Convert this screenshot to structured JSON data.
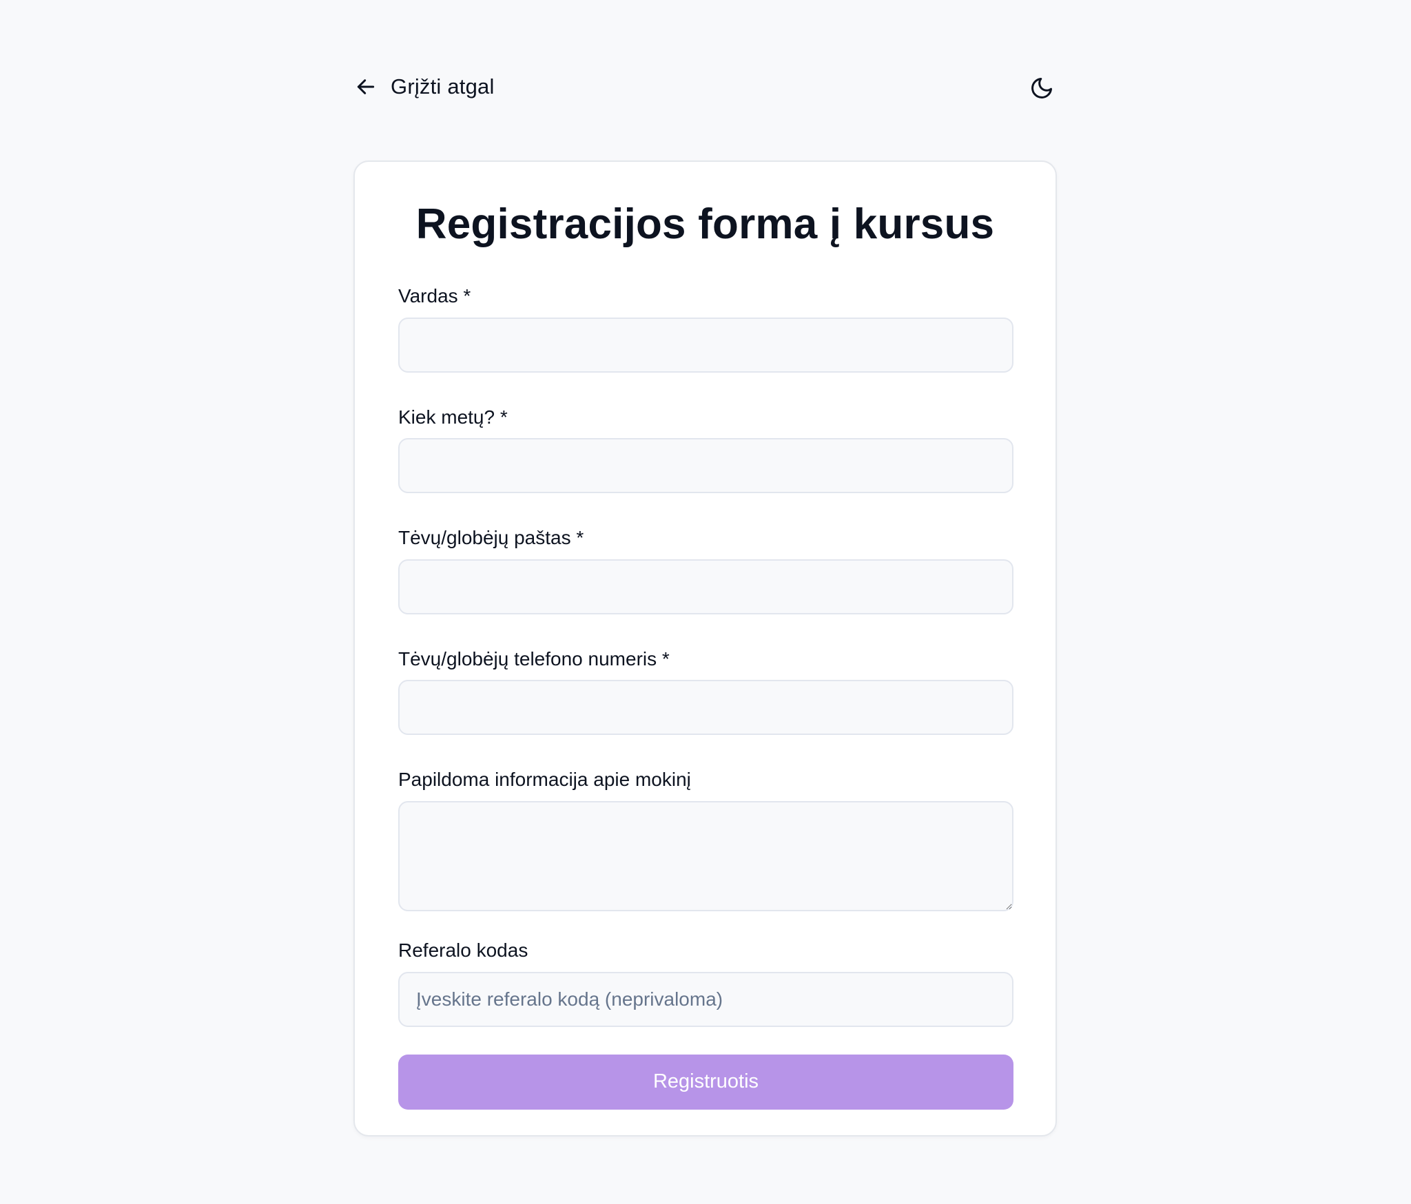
{
  "nav": {
    "back_label": "Grįžti atgal"
  },
  "form": {
    "title": "Registracijos forma į kursus",
    "fields": [
      {
        "label": "Vardas *",
        "value": "",
        "placeholder": ""
      },
      {
        "label": "Kiek metų? *",
        "value": "",
        "placeholder": ""
      },
      {
        "label": "Tėvų/globėjų paštas *",
        "value": "",
        "placeholder": ""
      },
      {
        "label": "Tėvų/globėjų telefono numeris *",
        "value": "",
        "placeholder": ""
      },
      {
        "label": "Papildoma informacija apie mokinį",
        "value": "",
        "placeholder": ""
      },
      {
        "label": "Referalo kodas",
        "value": "",
        "placeholder": "Įveskite referalo kodą (neprivaloma)"
      }
    ],
    "submit_label": "Registruotis"
  },
  "icons": {
    "back": "arrow-left-icon",
    "theme": "moon-icon"
  },
  "colors": {
    "background": "#f8f9fb",
    "card": "#ffffff",
    "accent": "#b794e8",
    "text": "#0d1320",
    "placeholder": "#66758c"
  }
}
